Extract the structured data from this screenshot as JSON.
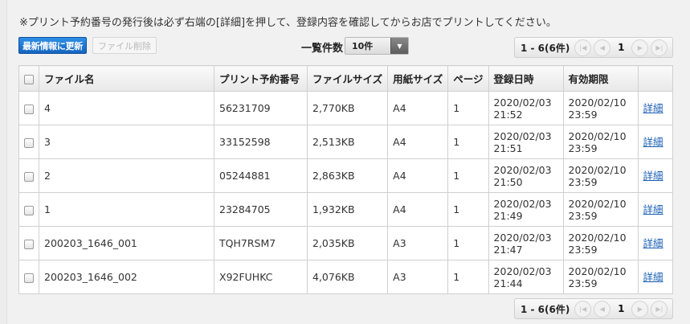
{
  "notice": "※プリント予約番号の発行後は必ず右端の[詳細]を押して、登録内容を確認してからお店でプリントしてください。",
  "toolbar": {
    "refresh_label": "最新情報に更新",
    "delete_label": "ファイル削除",
    "perpage_label": "一覧件数",
    "perpage_value": "10件"
  },
  "pager": {
    "range": "1 - 6(6件)",
    "current_page": "1",
    "icons": [
      "first-page-icon",
      "prev-page-icon",
      "next-page-icon",
      "last-page-icon"
    ]
  },
  "table": {
    "headers": {
      "filename": "ファイル名",
      "reserve_no": "プリント予約番号",
      "filesize": "ファイルサイズ",
      "paper": "用紙サイズ",
      "pages": "ページ",
      "registered": "登録日時",
      "expires": "有効期限"
    },
    "detail_label": "詳細",
    "rows": [
      {
        "filename": "4",
        "reserve_no": "56231709",
        "filesize": "2,770KB",
        "paper": "A4",
        "pages": "1",
        "reg_date": "2020/02/03",
        "reg_time": "21:52",
        "exp_date": "2020/02/10",
        "exp_time": "23:59"
      },
      {
        "filename": "3",
        "reserve_no": "33152598",
        "filesize": "2,513KB",
        "paper": "A4",
        "pages": "1",
        "reg_date": "2020/02/03",
        "reg_time": "21:51",
        "exp_date": "2020/02/10",
        "exp_time": "23:59"
      },
      {
        "filename": "2",
        "reserve_no": "05244881",
        "filesize": "2,863KB",
        "paper": "A4",
        "pages": "1",
        "reg_date": "2020/02/03",
        "reg_time": "21:50",
        "exp_date": "2020/02/10",
        "exp_time": "23:59"
      },
      {
        "filename": "1",
        "reserve_no": "23284705",
        "filesize": "1,932KB",
        "paper": "A4",
        "pages": "1",
        "reg_date": "2020/02/03",
        "reg_time": "21:49",
        "exp_date": "2020/02/10",
        "exp_time": "23:59"
      },
      {
        "filename": "200203_1646_001",
        "reserve_no": "TQH7RSM7",
        "filesize": "2,035KB",
        "paper": "A3",
        "pages": "1",
        "reg_date": "2020/02/03",
        "reg_time": "21:47",
        "exp_date": "2020/02/10",
        "exp_time": "23:59"
      },
      {
        "filename": "200203_1646_002",
        "reserve_no": "X92FUHKC",
        "filesize": "4,076KB",
        "paper": "A3",
        "pages": "1",
        "reg_date": "2020/02/03",
        "reg_time": "21:44",
        "exp_date": "2020/02/10",
        "exp_time": "23:59"
      }
    ]
  }
}
